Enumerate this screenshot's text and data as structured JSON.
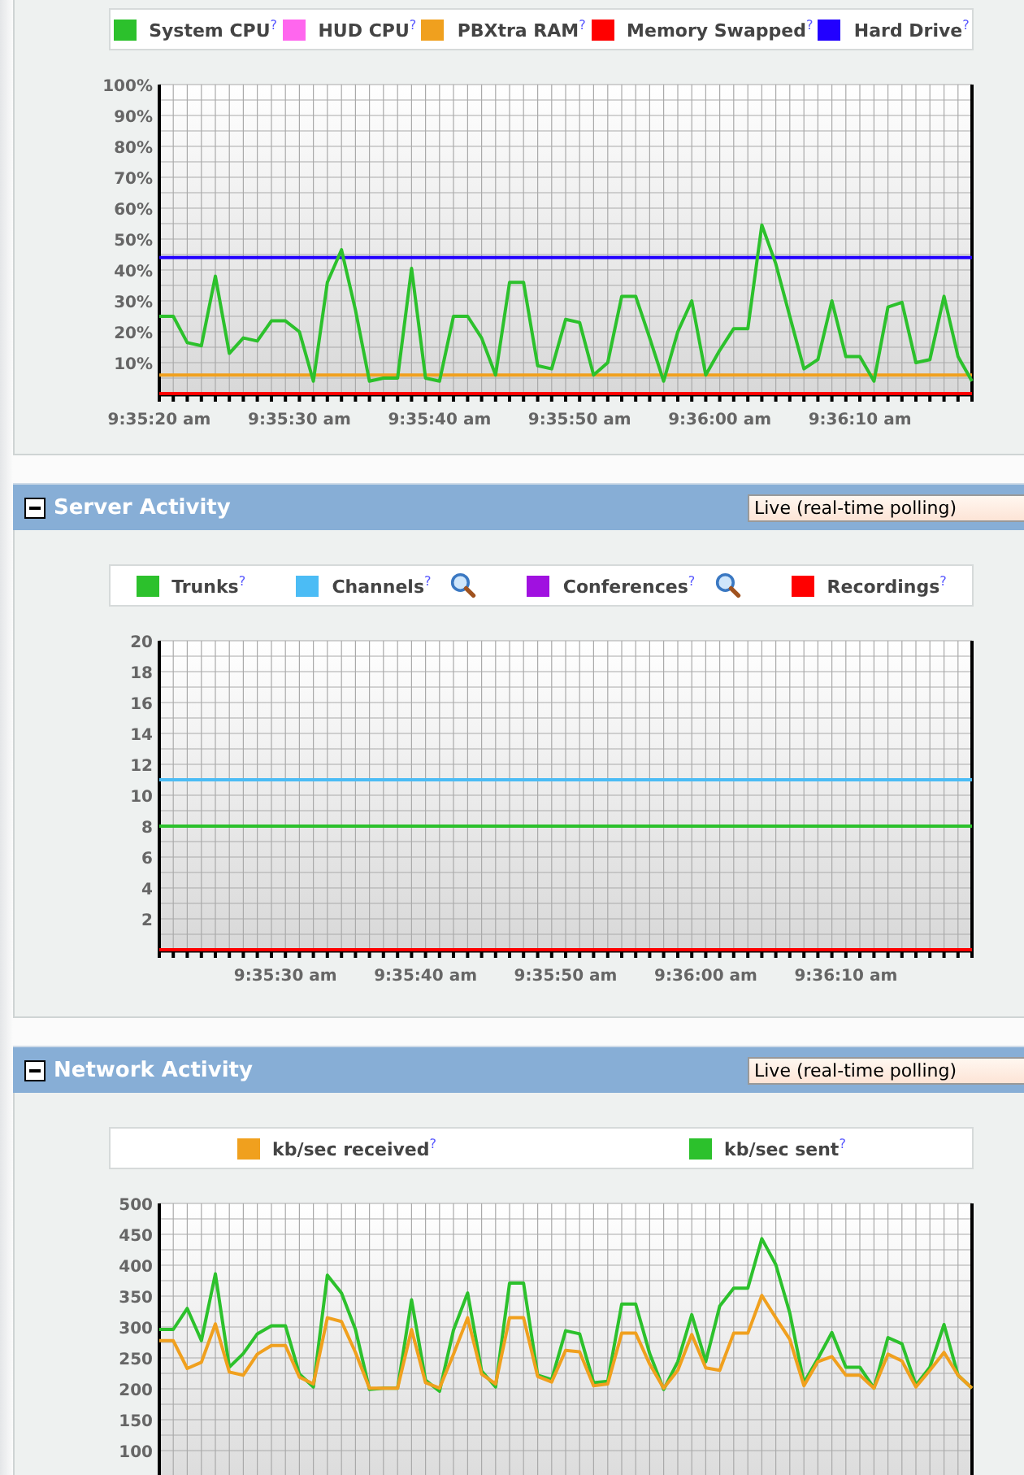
{
  "panels": [
    {
      "chart_data": {
        "type": "line",
        "grid": true,
        "categories": [
          "9:35:20 am",
          null,
          null,
          null,
          null,
          null,
          null,
          null,
          null,
          null,
          "9:35:30 am",
          null,
          null,
          null,
          null,
          null,
          null,
          null,
          null,
          null,
          "9:35:40 am",
          null,
          null,
          null,
          null,
          null,
          null,
          null,
          null,
          null,
          "9:35:50 am",
          null,
          null,
          null,
          null,
          null,
          null,
          null,
          null,
          null,
          "9:36:00 am",
          null,
          null,
          null,
          null,
          null,
          null,
          null,
          null,
          null,
          "9:36:10 am",
          null,
          null,
          null,
          null,
          null,
          null,
          null,
          null
        ],
        "ylim": [
          0,
          100
        ],
        "yticks": [
          {
            "value": 10,
            "label": "10%"
          },
          {
            "value": 20,
            "label": "20%"
          },
          {
            "value": 30,
            "label": "30%"
          },
          {
            "value": 40,
            "label": "40%"
          },
          {
            "value": 50,
            "label": "50%"
          },
          {
            "value": 60,
            "label": "60%"
          },
          {
            "value": 70,
            "label": "70%"
          },
          {
            "value": 80,
            "label": "80%"
          },
          {
            "value": 90,
            "label": "90%"
          },
          {
            "value": 100,
            "label": "100%"
          }
        ],
        "series": [
          {
            "name": "System CPU$^{?}$",
            "color": "#2cc12c",
            "values": [
              25,
              25,
              16.5,
              15.5,
              38,
              13,
              18,
              17,
              23.5,
              23.5,
              20,
              4,
              36,
              46.5,
              27,
              4,
              5,
              5,
              40.5,
              5,
              4,
              25,
              25,
              18,
              6,
              36,
              36,
              9,
              8,
              24,
              23,
              6,
              10,
              31.5,
              31.5,
              18,
              4,
              20,
              30,
              6,
              14,
              21,
              21,
              54.5,
              42,
              25,
              8,
              11,
              30,
              12,
              12,
              4,
              28,
              29.5,
              10,
              11,
              31.5,
              12,
              4
            ]
          },
          {
            "name": "HUD CPU$^{?}$",
            "color": "#ff66ee",
            "values": [
              null,
              null,
              null,
              null,
              null,
              null,
              null,
              null,
              null,
              null,
              null,
              null,
              null,
              null,
              null,
              null,
              null,
              null,
              null,
              null,
              null,
              null,
              null,
              null,
              null,
              null,
              null,
              null,
              null,
              null,
              null,
              null,
              null,
              null,
              null,
              null,
              null,
              null,
              null,
              null,
              null,
              null,
              null,
              null,
              null,
              null,
              null,
              null,
              null,
              null,
              null,
              null,
              null,
              null,
              null,
              null,
              null,
              null,
              null
            ]
          },
          {
            "name": "PBXtra RAM$^{?}$",
            "color": "#f0a01e",
            "values": [
              6,
              6,
              6,
              6,
              6,
              6,
              6,
              6,
              6,
              6,
              6,
              6,
              6,
              6,
              6,
              6,
              6,
              6,
              6,
              6,
              6,
              6,
              6,
              6,
              6,
              6,
              6,
              6,
              6,
              6,
              6,
              6,
              6,
              6,
              6,
              6,
              6,
              6,
              6,
              6,
              6,
              6,
              6,
              6,
              6,
              6,
              6,
              6,
              6,
              6,
              6,
              6,
              6,
              6,
              6,
              6,
              6,
              6,
              6
            ]
          },
          {
            "name": "Memory Swapped$^{?}$",
            "color": "#ff0000",
            "values": [
              0,
              0,
              0,
              0,
              0,
              0,
              0,
              0,
              0,
              0,
              0,
              0,
              0,
              0,
              0,
              0,
              0,
              0,
              0,
              0,
              0,
              0,
              0,
              0,
              0,
              0,
              0,
              0,
              0,
              0,
              0,
              0,
              0,
              0,
              0,
              0,
              0,
              0,
              0,
              0,
              0,
              0,
              0,
              0,
              0,
              0,
              0,
              0,
              0,
              0,
              0,
              0,
              0,
              0,
              0,
              0,
              0,
              0,
              0
            ]
          },
          {
            "name": "Hard Drive$^{?}$",
            "color": "#2200ff",
            "values": [
              44,
              44,
              44,
              44,
              44,
              44,
              44,
              44,
              44,
              44,
              44,
              44,
              44,
              44,
              44,
              44,
              44,
              44,
              44,
              44,
              44,
              44,
              44,
              44,
              44,
              44,
              44,
              44,
              44,
              44,
              44,
              44,
              44,
              44,
              44,
              44,
              44,
              44,
              44,
              44,
              44,
              44,
              44,
              44,
              44,
              44,
              44,
              44,
              44,
              44,
              44,
              44,
              44,
              44,
              44,
              44,
              44,
              44,
              44
            ]
          }
        ]
      }
    },
    {
      "title": "Server Activity",
      "dropdown": "Live (real-time polling)",
      "legend": [
        {
          "magnifier": false
        },
        {
          "magnifier": true
        },
        {
          "magnifier": true
        },
        {
          "magnifier": false
        }
      ],
      "chart_data": {
        "type": "line",
        "grid": true,
        "categories": [
          null,
          null,
          null,
          null,
          null,
          null,
          null,
          null,
          null,
          "9:35:30 am",
          null,
          null,
          null,
          null,
          null,
          null,
          null,
          null,
          null,
          "9:35:40 am",
          null,
          null,
          null,
          null,
          null,
          null,
          null,
          null,
          null,
          "9:35:50 am",
          null,
          null,
          null,
          null,
          null,
          null,
          null,
          null,
          null,
          "9:36:00 am",
          null,
          null,
          null,
          null,
          null,
          null,
          null,
          null,
          null,
          "9:36:10 am",
          null,
          null,
          null,
          null,
          null,
          null,
          null,
          null,
          null
        ],
        "ylim": [
          0,
          20
        ],
        "yticks": [
          2,
          4,
          6,
          8,
          10,
          12,
          14,
          16,
          18,
          20
        ],
        "series": [
          {
            "name": "Trunks$^{?}$",
            "color": "#2cc12c",
            "values": [
              8,
              8,
              8,
              8,
              8,
              8,
              8,
              8,
              8,
              8,
              8,
              8,
              8,
              8,
              8,
              8,
              8,
              8,
              8,
              8,
              8,
              8,
              8,
              8,
              8,
              8,
              8,
              8,
              8,
              8,
              8,
              8,
              8,
              8,
              8,
              8,
              8,
              8,
              8,
              8,
              8,
              8,
              8,
              8,
              8,
              8,
              8,
              8,
              8,
              8,
              8,
              8,
              8,
              8,
              8,
              8,
              8,
              8,
              8
            ]
          },
          {
            "name": "Channels$^{?}$",
            "color": "#4bbcf5",
            "values": [
              11,
              11,
              11,
              11,
              11,
              11,
              11,
              11,
              11,
              11,
              11,
              11,
              11,
              11,
              11,
              11,
              11,
              11,
              11,
              11,
              11,
              11,
              11,
              11,
              11,
              11,
              11,
              11,
              11,
              11,
              11,
              11,
              11,
              11,
              11,
              11,
              11,
              11,
              11,
              11,
              11,
              11,
              11,
              11,
              11,
              11,
              11,
              11,
              11,
              11,
              11,
              11,
              11,
              11,
              11,
              11,
              11,
              11,
              11
            ]
          },
          {
            "name": "Conferences$^{?}$",
            "color": "#a011e0",
            "values": [
              null,
              null,
              null,
              null,
              null,
              null,
              null,
              null,
              null,
              null,
              null,
              null,
              null,
              null,
              null,
              null,
              null,
              null,
              null,
              null,
              null,
              null,
              null,
              null,
              null,
              null,
              null,
              null,
              null,
              null,
              null,
              null,
              null,
              null,
              null,
              null,
              null,
              null,
              null,
              null,
              null,
              null,
              null,
              null,
              null,
              null,
              null,
              null,
              null,
              null,
              null,
              null,
              null,
              null,
              null,
              null,
              null,
              null,
              null
            ]
          },
          {
            "name": "Recordings$^{?}$",
            "color": "#ff0000",
            "values": [
              0,
              0,
              0,
              0,
              0,
              0,
              0,
              0,
              0,
              0,
              0,
              0,
              0,
              0,
              0,
              0,
              0,
              0,
              0,
              0,
              0,
              0,
              0,
              0,
              0,
              0,
              0,
              0,
              0,
              0,
              0,
              0,
              0,
              0,
              0,
              0,
              0,
              0,
              0,
              0,
              0,
              0,
              0,
              0,
              0,
              0,
              0,
              0,
              0,
              0,
              0,
              0,
              0,
              0,
              0,
              0,
              0,
              0,
              0
            ]
          }
        ]
      }
    },
    {
      "title": "Network Activity",
      "dropdown": "Live (real-time polling)",
      "chart_data": {
        "type": "line",
        "grid": true,
        "ylim": [
          0,
          500
        ],
        "yticks": [
          100,
          150,
          200,
          250,
          300,
          350,
          400,
          450,
          500
        ],
        "series": [
          {
            "name": "kb/sec received$^{?}$",
            "color": "#f0a01e",
            "values": [
              278,
              278,
              233,
              243,
              305,
              227,
              222,
              256,
              270,
              270,
              219,
              208,
              315,
              309,
              259,
              201,
              201,
              201,
              296,
              210,
              201,
              256,
              315,
              224,
              208,
              315,
              315,
              220,
              211,
              262,
              260,
              205,
              208,
              290,
              290,
              240,
              201,
              230,
              288,
              234,
              230,
              290,
              290,
              351,
              315,
              280,
              205,
              244,
              252,
              222,
              222,
              201,
              256,
              245,
              203,
              230,
              259,
              222,
              201
            ]
          },
          {
            "name": "kb/sec sent$^{?}$",
            "color": "#2cc12c",
            "values": [
              296,
              296,
              330,
              278,
              386,
              235,
              257,
              289,
              302,
              302,
              224,
              203,
              384,
              355,
              296,
              199,
              201,
              201,
              344,
              214,
              196,
              295,
              355,
              229,
              203,
              371,
              371,
              222,
              215,
              294,
              289,
              210,
              212,
              337,
              337,
              257,
              199,
              244,
              320,
              244,
              334,
              363,
              363,
              443,
              401,
              323,
              210,
              249,
              291,
              235,
              235,
              201,
              283,
              273,
              206,
              235,
              304,
              222,
              201
            ]
          }
        ]
      }
    }
  ]
}
